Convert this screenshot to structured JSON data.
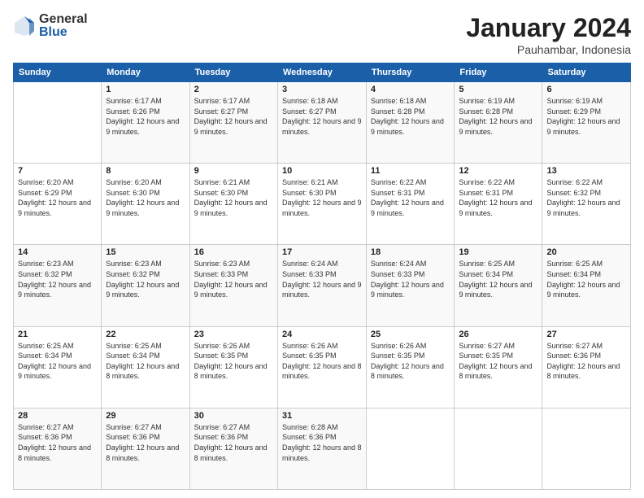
{
  "logo": {
    "general": "General",
    "blue": "Blue"
  },
  "title": "January 2024",
  "location": "Pauhambar, Indonesia",
  "weekdays": [
    "Sunday",
    "Monday",
    "Tuesday",
    "Wednesday",
    "Thursday",
    "Friday",
    "Saturday"
  ],
  "weeks": [
    [
      {
        "day": "",
        "sunrise": "",
        "sunset": "",
        "daylight": ""
      },
      {
        "day": "1",
        "sunrise": "Sunrise: 6:17 AM",
        "sunset": "Sunset: 6:26 PM",
        "daylight": "Daylight: 12 hours and 9 minutes."
      },
      {
        "day": "2",
        "sunrise": "Sunrise: 6:17 AM",
        "sunset": "Sunset: 6:27 PM",
        "daylight": "Daylight: 12 hours and 9 minutes."
      },
      {
        "day": "3",
        "sunrise": "Sunrise: 6:18 AM",
        "sunset": "Sunset: 6:27 PM",
        "daylight": "Daylight: 12 hours and 9 minutes."
      },
      {
        "day": "4",
        "sunrise": "Sunrise: 6:18 AM",
        "sunset": "Sunset: 6:28 PM",
        "daylight": "Daylight: 12 hours and 9 minutes."
      },
      {
        "day": "5",
        "sunrise": "Sunrise: 6:19 AM",
        "sunset": "Sunset: 6:28 PM",
        "daylight": "Daylight: 12 hours and 9 minutes."
      },
      {
        "day": "6",
        "sunrise": "Sunrise: 6:19 AM",
        "sunset": "Sunset: 6:29 PM",
        "daylight": "Daylight: 12 hours and 9 minutes."
      }
    ],
    [
      {
        "day": "7",
        "sunrise": "Sunrise: 6:20 AM",
        "sunset": "Sunset: 6:29 PM",
        "daylight": "Daylight: 12 hours and 9 minutes."
      },
      {
        "day": "8",
        "sunrise": "Sunrise: 6:20 AM",
        "sunset": "Sunset: 6:30 PM",
        "daylight": "Daylight: 12 hours and 9 minutes."
      },
      {
        "day": "9",
        "sunrise": "Sunrise: 6:21 AM",
        "sunset": "Sunset: 6:30 PM",
        "daylight": "Daylight: 12 hours and 9 minutes."
      },
      {
        "day": "10",
        "sunrise": "Sunrise: 6:21 AM",
        "sunset": "Sunset: 6:30 PM",
        "daylight": "Daylight: 12 hours and 9 minutes."
      },
      {
        "day": "11",
        "sunrise": "Sunrise: 6:22 AM",
        "sunset": "Sunset: 6:31 PM",
        "daylight": "Daylight: 12 hours and 9 minutes."
      },
      {
        "day": "12",
        "sunrise": "Sunrise: 6:22 AM",
        "sunset": "Sunset: 6:31 PM",
        "daylight": "Daylight: 12 hours and 9 minutes."
      },
      {
        "day": "13",
        "sunrise": "Sunrise: 6:22 AM",
        "sunset": "Sunset: 6:32 PM",
        "daylight": "Daylight: 12 hours and 9 minutes."
      }
    ],
    [
      {
        "day": "14",
        "sunrise": "Sunrise: 6:23 AM",
        "sunset": "Sunset: 6:32 PM",
        "daylight": "Daylight: 12 hours and 9 minutes."
      },
      {
        "day": "15",
        "sunrise": "Sunrise: 6:23 AM",
        "sunset": "Sunset: 6:32 PM",
        "daylight": "Daylight: 12 hours and 9 minutes."
      },
      {
        "day": "16",
        "sunrise": "Sunrise: 6:23 AM",
        "sunset": "Sunset: 6:33 PM",
        "daylight": "Daylight: 12 hours and 9 minutes."
      },
      {
        "day": "17",
        "sunrise": "Sunrise: 6:24 AM",
        "sunset": "Sunset: 6:33 PM",
        "daylight": "Daylight: 12 hours and 9 minutes."
      },
      {
        "day": "18",
        "sunrise": "Sunrise: 6:24 AM",
        "sunset": "Sunset: 6:33 PM",
        "daylight": "Daylight: 12 hours and 9 minutes."
      },
      {
        "day": "19",
        "sunrise": "Sunrise: 6:25 AM",
        "sunset": "Sunset: 6:34 PM",
        "daylight": "Daylight: 12 hours and 9 minutes."
      },
      {
        "day": "20",
        "sunrise": "Sunrise: 6:25 AM",
        "sunset": "Sunset: 6:34 PM",
        "daylight": "Daylight: 12 hours and 9 minutes."
      }
    ],
    [
      {
        "day": "21",
        "sunrise": "Sunrise: 6:25 AM",
        "sunset": "Sunset: 6:34 PM",
        "daylight": "Daylight: 12 hours and 9 minutes."
      },
      {
        "day": "22",
        "sunrise": "Sunrise: 6:25 AM",
        "sunset": "Sunset: 6:34 PM",
        "daylight": "Daylight: 12 hours and 8 minutes."
      },
      {
        "day": "23",
        "sunrise": "Sunrise: 6:26 AM",
        "sunset": "Sunset: 6:35 PM",
        "daylight": "Daylight: 12 hours and 8 minutes."
      },
      {
        "day": "24",
        "sunrise": "Sunrise: 6:26 AM",
        "sunset": "Sunset: 6:35 PM",
        "daylight": "Daylight: 12 hours and 8 minutes."
      },
      {
        "day": "25",
        "sunrise": "Sunrise: 6:26 AM",
        "sunset": "Sunset: 6:35 PM",
        "daylight": "Daylight: 12 hours and 8 minutes."
      },
      {
        "day": "26",
        "sunrise": "Sunrise: 6:27 AM",
        "sunset": "Sunset: 6:35 PM",
        "daylight": "Daylight: 12 hours and 8 minutes."
      },
      {
        "day": "27",
        "sunrise": "Sunrise: 6:27 AM",
        "sunset": "Sunset: 6:36 PM",
        "daylight": "Daylight: 12 hours and 8 minutes."
      }
    ],
    [
      {
        "day": "28",
        "sunrise": "Sunrise: 6:27 AM",
        "sunset": "Sunset: 6:36 PM",
        "daylight": "Daylight: 12 hours and 8 minutes."
      },
      {
        "day": "29",
        "sunrise": "Sunrise: 6:27 AM",
        "sunset": "Sunset: 6:36 PM",
        "daylight": "Daylight: 12 hours and 8 minutes."
      },
      {
        "day": "30",
        "sunrise": "Sunrise: 6:27 AM",
        "sunset": "Sunset: 6:36 PM",
        "daylight": "Daylight: 12 hours and 8 minutes."
      },
      {
        "day": "31",
        "sunrise": "Sunrise: 6:28 AM",
        "sunset": "Sunset: 6:36 PM",
        "daylight": "Daylight: 12 hours and 8 minutes."
      },
      {
        "day": "",
        "sunrise": "",
        "sunset": "",
        "daylight": ""
      },
      {
        "day": "",
        "sunrise": "",
        "sunset": "",
        "daylight": ""
      },
      {
        "day": "",
        "sunrise": "",
        "sunset": "",
        "daylight": ""
      }
    ]
  ]
}
